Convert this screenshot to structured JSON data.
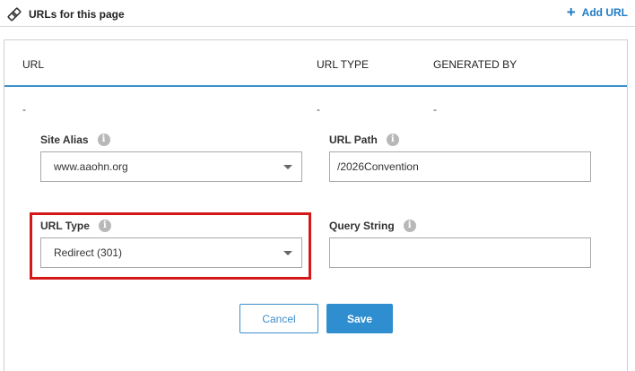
{
  "header": {
    "title": "URLs for this page",
    "icon": "link-icon",
    "add_url_label": "Add URL"
  },
  "table": {
    "columns": [
      "URL",
      "URL TYPE",
      "GENERATED BY"
    ],
    "row": [
      "-",
      "-",
      "-"
    ]
  },
  "form": {
    "site_alias": {
      "label": "Site Alias",
      "value": "www.aaohn.org"
    },
    "url_path": {
      "label": "URL Path",
      "value": "/2026Convention"
    },
    "url_type": {
      "label": "URL Type",
      "value": "Redirect (301)"
    },
    "query_string": {
      "label": "Query String",
      "value": ""
    },
    "info_glyph": "i"
  },
  "buttons": {
    "cancel": "Cancel",
    "save": "Save"
  },
  "colors": {
    "accent": "#2f8ed0",
    "highlight": "#d41818"
  }
}
